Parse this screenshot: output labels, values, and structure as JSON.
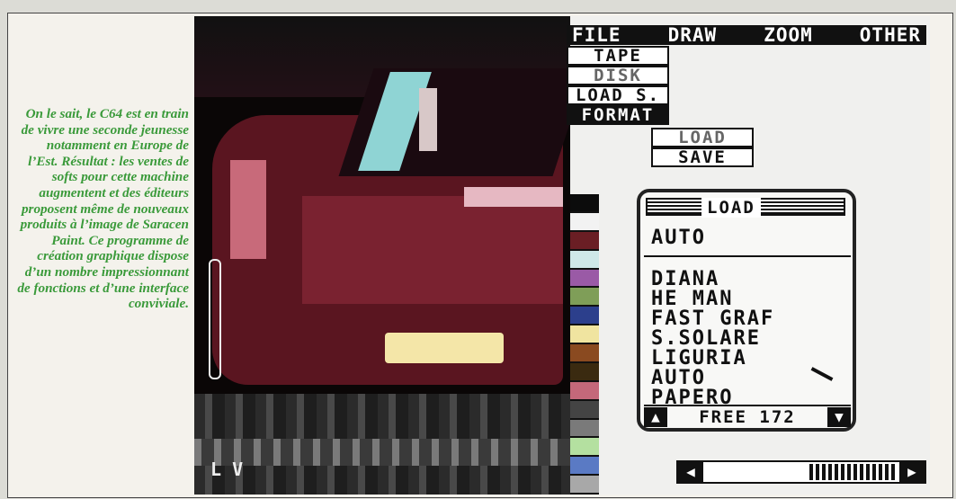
{
  "caption": {
    "text": "On le sait, le C64 est en train de vivre une seconde jeunesse notamment en Europe de l’Est. Résultat : les ventes de softs pour cette machine augmentent et des éditeurs proposent même de nouveaux produits à l’image de Saracen Paint. Ce programme de création graphique dispose d’un nombre impressionnant de fonctions et d’une interface conviviale."
  },
  "menubar": {
    "items": [
      "FILE",
      "DRAW",
      "ZOOM",
      "OTHER"
    ]
  },
  "file_menu": {
    "items": [
      "TAPE",
      "DISK",
      "LOAD S.",
      "FORMAT"
    ]
  },
  "disk_submenu": {
    "items": [
      "LOAD",
      "SAVE"
    ]
  },
  "load_dialog": {
    "title": "LOAD",
    "selected": "AUTO",
    "files": [
      "DIANA",
      "HE MAN",
      "FAST GRAF",
      "S.SOLARE",
      "LIGURIA",
      "AUTO",
      "PAPERO"
    ],
    "free_label": "FREE 172"
  },
  "corner_label": "L V",
  "palette": {
    "colors": [
      "#0c0c0c",
      "#f2f2f2",
      "#6a1e24",
      "#cfe8e8",
      "#9a5aa6",
      "#7f9e58",
      "#2c3f8c",
      "#f0e4a0",
      "#8a4a20",
      "#3a2a10",
      "#c4687a",
      "#444444",
      "#7a7a7a",
      "#b4e0a0",
      "#5a7ac4",
      "#a8a8a8"
    ]
  }
}
